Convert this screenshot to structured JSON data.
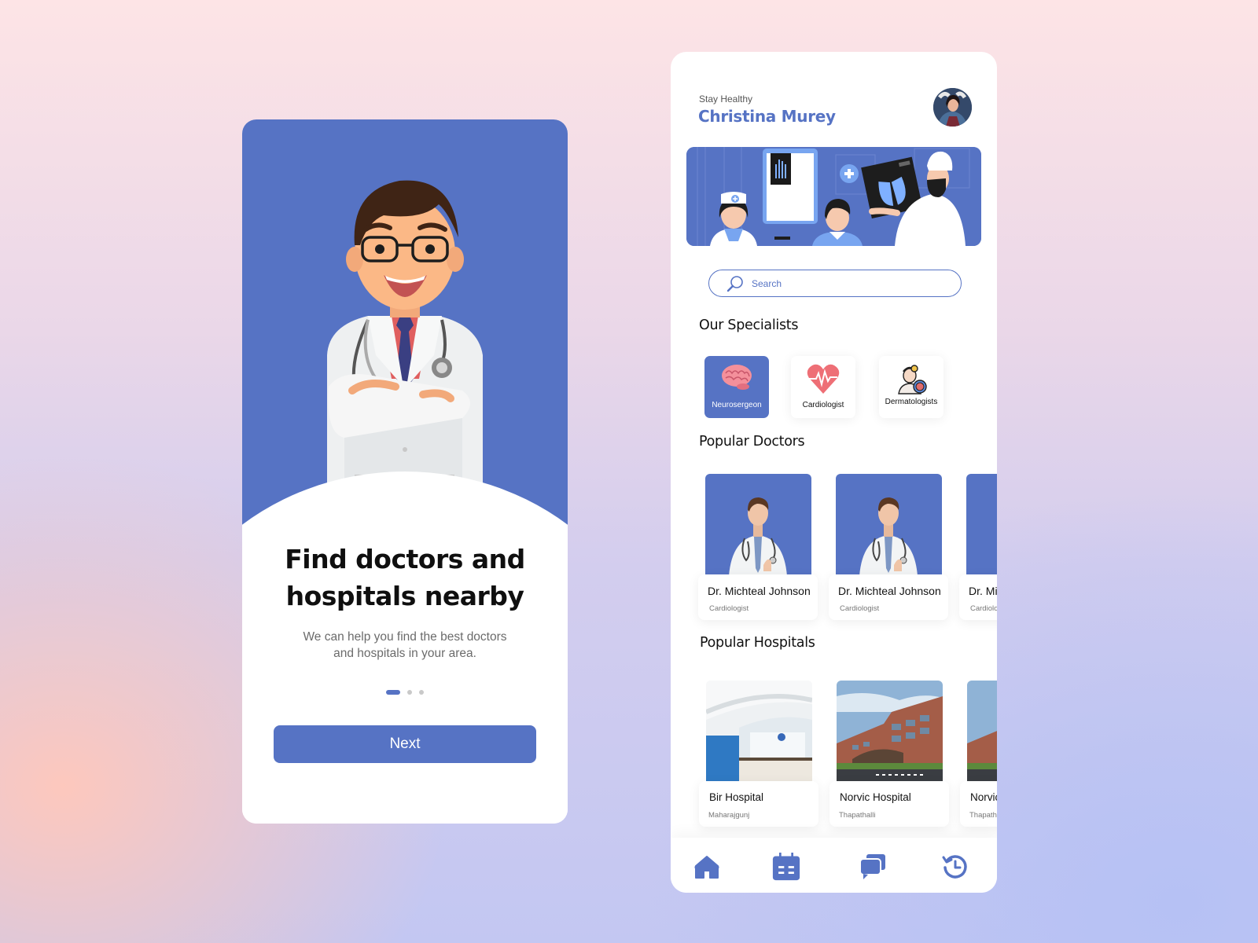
{
  "theme": {
    "primary": "#5673c4",
    "white": "#ffffff",
    "text": "#111111",
    "muted": "#777777"
  },
  "onboarding": {
    "title_line1": "Find doctors and",
    "title_line2": "hospitals nearby",
    "subtitle_line1": "We can help you find the best doctors",
    "subtitle_line2": "and hospitals in your area.",
    "pager": {
      "total": 3,
      "current": 1
    },
    "next_label": "Next",
    "illustration": "cartoon-doctor-illustration"
  },
  "home": {
    "greeting": "Stay Healthy",
    "user_name": "Christina Murey",
    "avatar": "user-avatar-photo",
    "banner": "medical-staff-xray-illustration",
    "search": {
      "placeholder": "Search",
      "value": ""
    },
    "specialists_title": "Our Specialists",
    "specialists": [
      {
        "label": "Neurosergeon",
        "icon": "brain-icon",
        "active": true
      },
      {
        "label": "Cardiologist",
        "icon": "heart-pulse-icon",
        "active": false
      },
      {
        "label": "Dermatologists",
        "icon": "dermatologist-icon",
        "active": false
      }
    ],
    "doctors_title": "Popular Doctors",
    "doctors": [
      {
        "name": "Dr. Michteal Johnson",
        "role": "Cardiologist"
      },
      {
        "name": "Dr. Michteal Johnson",
        "role": "Cardiologist"
      },
      {
        "name": "Dr. Michteal Johnson",
        "role": "Cardiologist"
      }
    ],
    "hospitals_title": "Popular Hospitals",
    "hospitals": [
      {
        "name": "Bir Hospital",
        "location": "Maharajgunj"
      },
      {
        "name": "Norvic Hospital",
        "location": "Thapathalli"
      },
      {
        "name": "Norvic Hospital",
        "location": "Thapathalli"
      }
    ],
    "nav": [
      {
        "name": "home",
        "icon": "home-icon",
        "active": true
      },
      {
        "name": "appointments",
        "icon": "calendar-icon",
        "active": false
      },
      {
        "name": "messages",
        "icon": "chat-icon",
        "active": false
      },
      {
        "name": "history",
        "icon": "history-icon",
        "active": false
      }
    ]
  }
}
